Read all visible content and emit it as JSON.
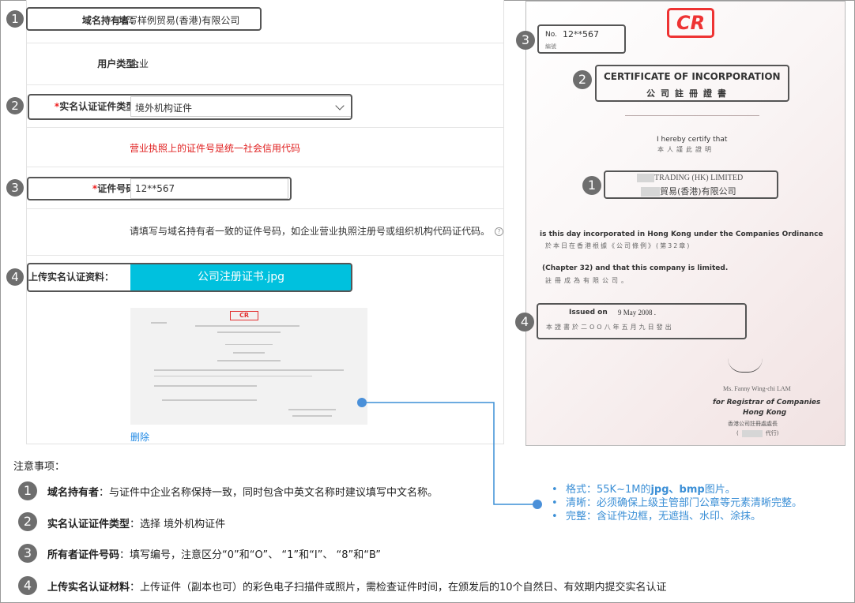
{
  "form": {
    "rows": [
      {
        "label": "域名持有者：",
        "value": "填写样例贸易(香港)有限公司"
      },
      {
        "label": "用户类型:",
        "value": "企业"
      },
      {
        "label_req": "*",
        "label": "实名认证证件类型:",
        "select_value": "境外机构证件"
      },
      {
        "tip": "营业执照上的证件号是统一社会信用代码"
      },
      {
        "label_req": "*",
        "label": "证件号码:",
        "input_value": "12**567"
      },
      {
        "help": "请填写与域名持有者一致的证件号码，如企业营业执照注册号或组织机构代码证代码。",
        "help_icon": "?"
      },
      {
        "label": "上传实名认证资料：",
        "upload_label": "公司注册证书.jpg"
      }
    ],
    "thumb_logo": "CR",
    "delete_label": "删除"
  },
  "badges": [
    "1",
    "2",
    "3",
    "4"
  ],
  "certificate": {
    "logo": "CR",
    "no_label": "No.",
    "no_value": "12**567",
    "no_zh": "編號",
    "title_en": "CERTIFICATE OF INCORPORATION",
    "title_zh": "公司註冊證書",
    "certify_en": "I hereby certify that",
    "certify_zh": "本人謹此證明",
    "company_en": "TRADING (HK) LIMITED",
    "company_zh": "貿易(香港)有限公司",
    "line1_en": "is this day incorporated in Hong Kong under the Companies Ordinance",
    "line1_zh": "於本日在香港根據《公司條例》(第32章)",
    "line2_en": "(Chapter 32) and that this company is limited.",
    "line2_zh": "註冊成為有限公司。",
    "issued_label": "Issued on",
    "issued_date": "9 May 2008 .",
    "issued_zh": "本證書於二OO八年五月九日發出",
    "signer": "Ms. Fanny Wing-chi LAM",
    "registrar_en": "for Registrar of Companies",
    "registrar_place": "Hong Kong",
    "registrar_zh": "香港公司註冊處處長",
    "registrar_paren_open": "(",
    "registrar_paren_close": "代行)"
  },
  "tips": [
    {
      "pre": "格式：55K~1M的",
      "bold": "jpg、bmp",
      "post": "图片。"
    },
    {
      "pre": "清晰：必须确保上级主管部门公章等元素清晰完整。",
      "bold": "",
      "post": ""
    },
    {
      "pre": "完整：含证件边框，无遮挡、水印、涂抹。",
      "bold": "",
      "post": ""
    }
  ],
  "notes": {
    "title": "注意事项：",
    "items": [
      {
        "num": "1",
        "bold": "域名持有者",
        "text": "：与证件中企业名称保持一致，同时包含中英文名称时建议填写中文名称。"
      },
      {
        "num": "2",
        "bold": "实名认证证件类型",
        "text": "：选择 境外机构证件"
      },
      {
        "num": "3",
        "bold": "所有者证件号码",
        "text": "：填写编号，注意区分“0”和“O”、 “1”和“I”、 “8”和“B”"
      },
      {
        "num": "4",
        "bold": "上传实名认证材料",
        "text": "：上传证件（副本也可）的彩色电子扫描件或照片，需检查证件时间，在颁发后的10个自然日、有效期内提交实名认证"
      }
    ]
  },
  "colors": {
    "accent": "#00c1de",
    "error": "#e02020",
    "link": "#1e88e5",
    "tip": "#3b8fd6",
    "badge": "#6e6e6e",
    "logo": "#e33333"
  }
}
